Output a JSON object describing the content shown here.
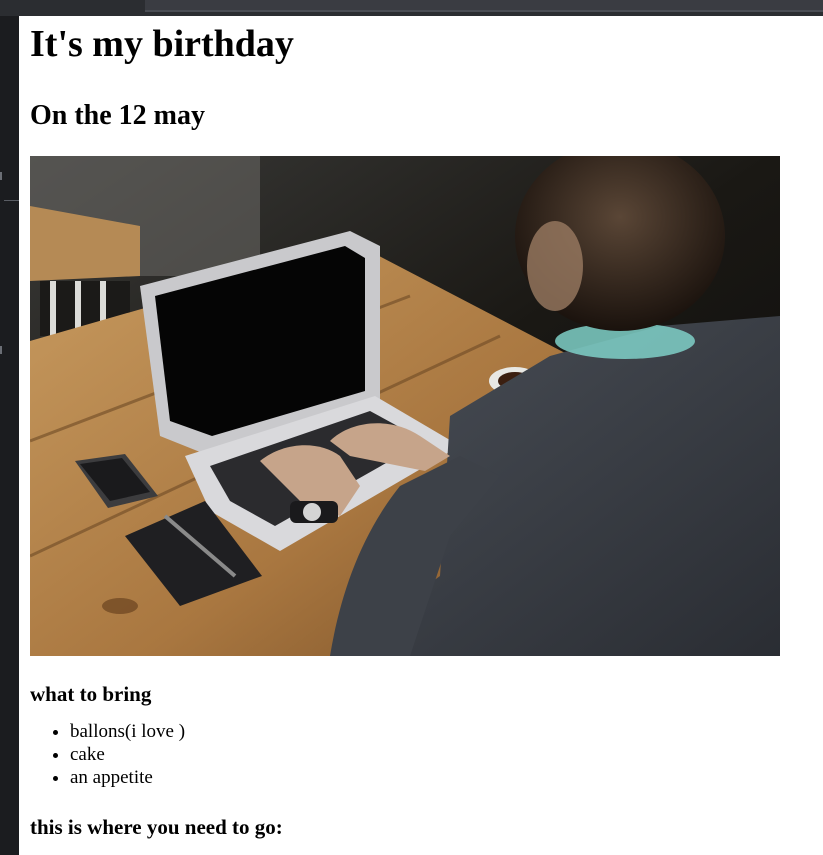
{
  "page": {
    "title": "It's my birthday",
    "subtitle": "On the 12 may",
    "photo_alt": "",
    "bring_heading": "what to bring",
    "bring_items": [
      "ballons(i love )",
      "cake",
      "an appetite"
    ],
    "location_heading": "this is where you need to go:"
  }
}
